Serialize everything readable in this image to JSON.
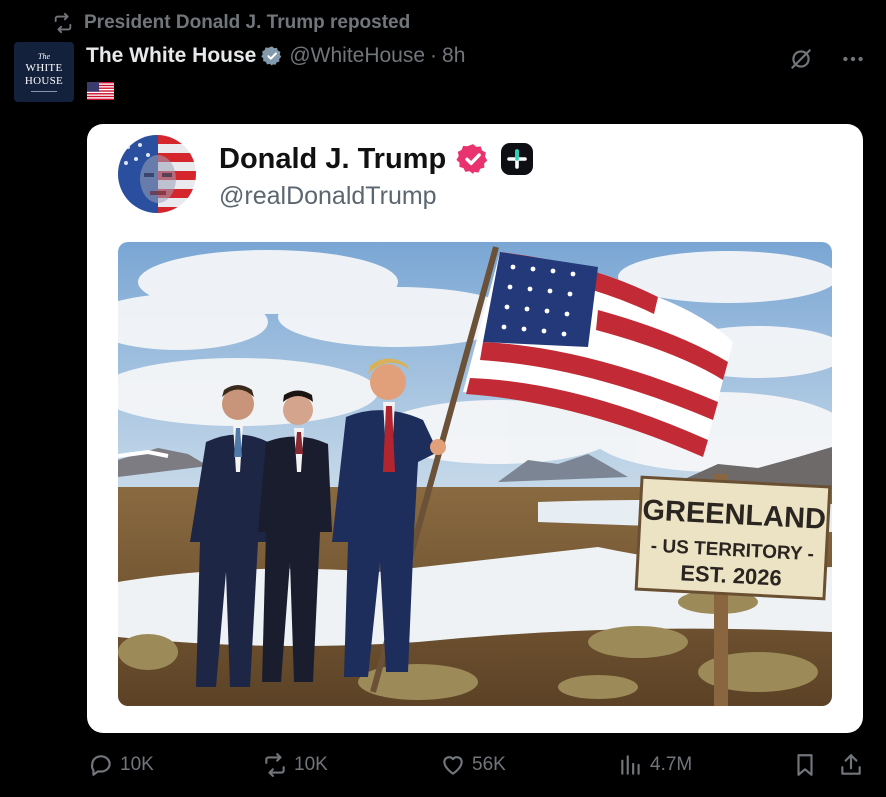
{
  "repost": {
    "text": "President Donald J. Trump reposted",
    "icon": "repost-icon"
  },
  "author": {
    "avatar_lines": [
      "The",
      "WHITE",
      "HOUSE"
    ],
    "name": "The White House",
    "handle": "@WhiteHouse",
    "separator": "·",
    "time": "8h",
    "verified_badge": "gray-verified-icon"
  },
  "post_text_emoji": "us-flag-emoji",
  "top_actions": {
    "grok_icon": "grok-icon",
    "more_icon": "more-icon"
  },
  "embedded": {
    "name": "Donald J. Trump",
    "handle": "@realDonaldTrump",
    "verified_badge": "pink-verified-icon",
    "extra_badge": "plus-badge-icon",
    "image": {
      "sign_lines": [
        "GREENLAND",
        "- US TERRITORY -",
        "EST. 2026"
      ]
    }
  },
  "actions": {
    "replies": "10K",
    "reposts": "10K",
    "likes": "56K",
    "views": "4.7M"
  },
  "colors": {
    "background": "#000000",
    "muted": "#71767b",
    "text": "#e7e9ea",
    "card": "#ffffff",
    "pink_badge": "#e8336e"
  }
}
